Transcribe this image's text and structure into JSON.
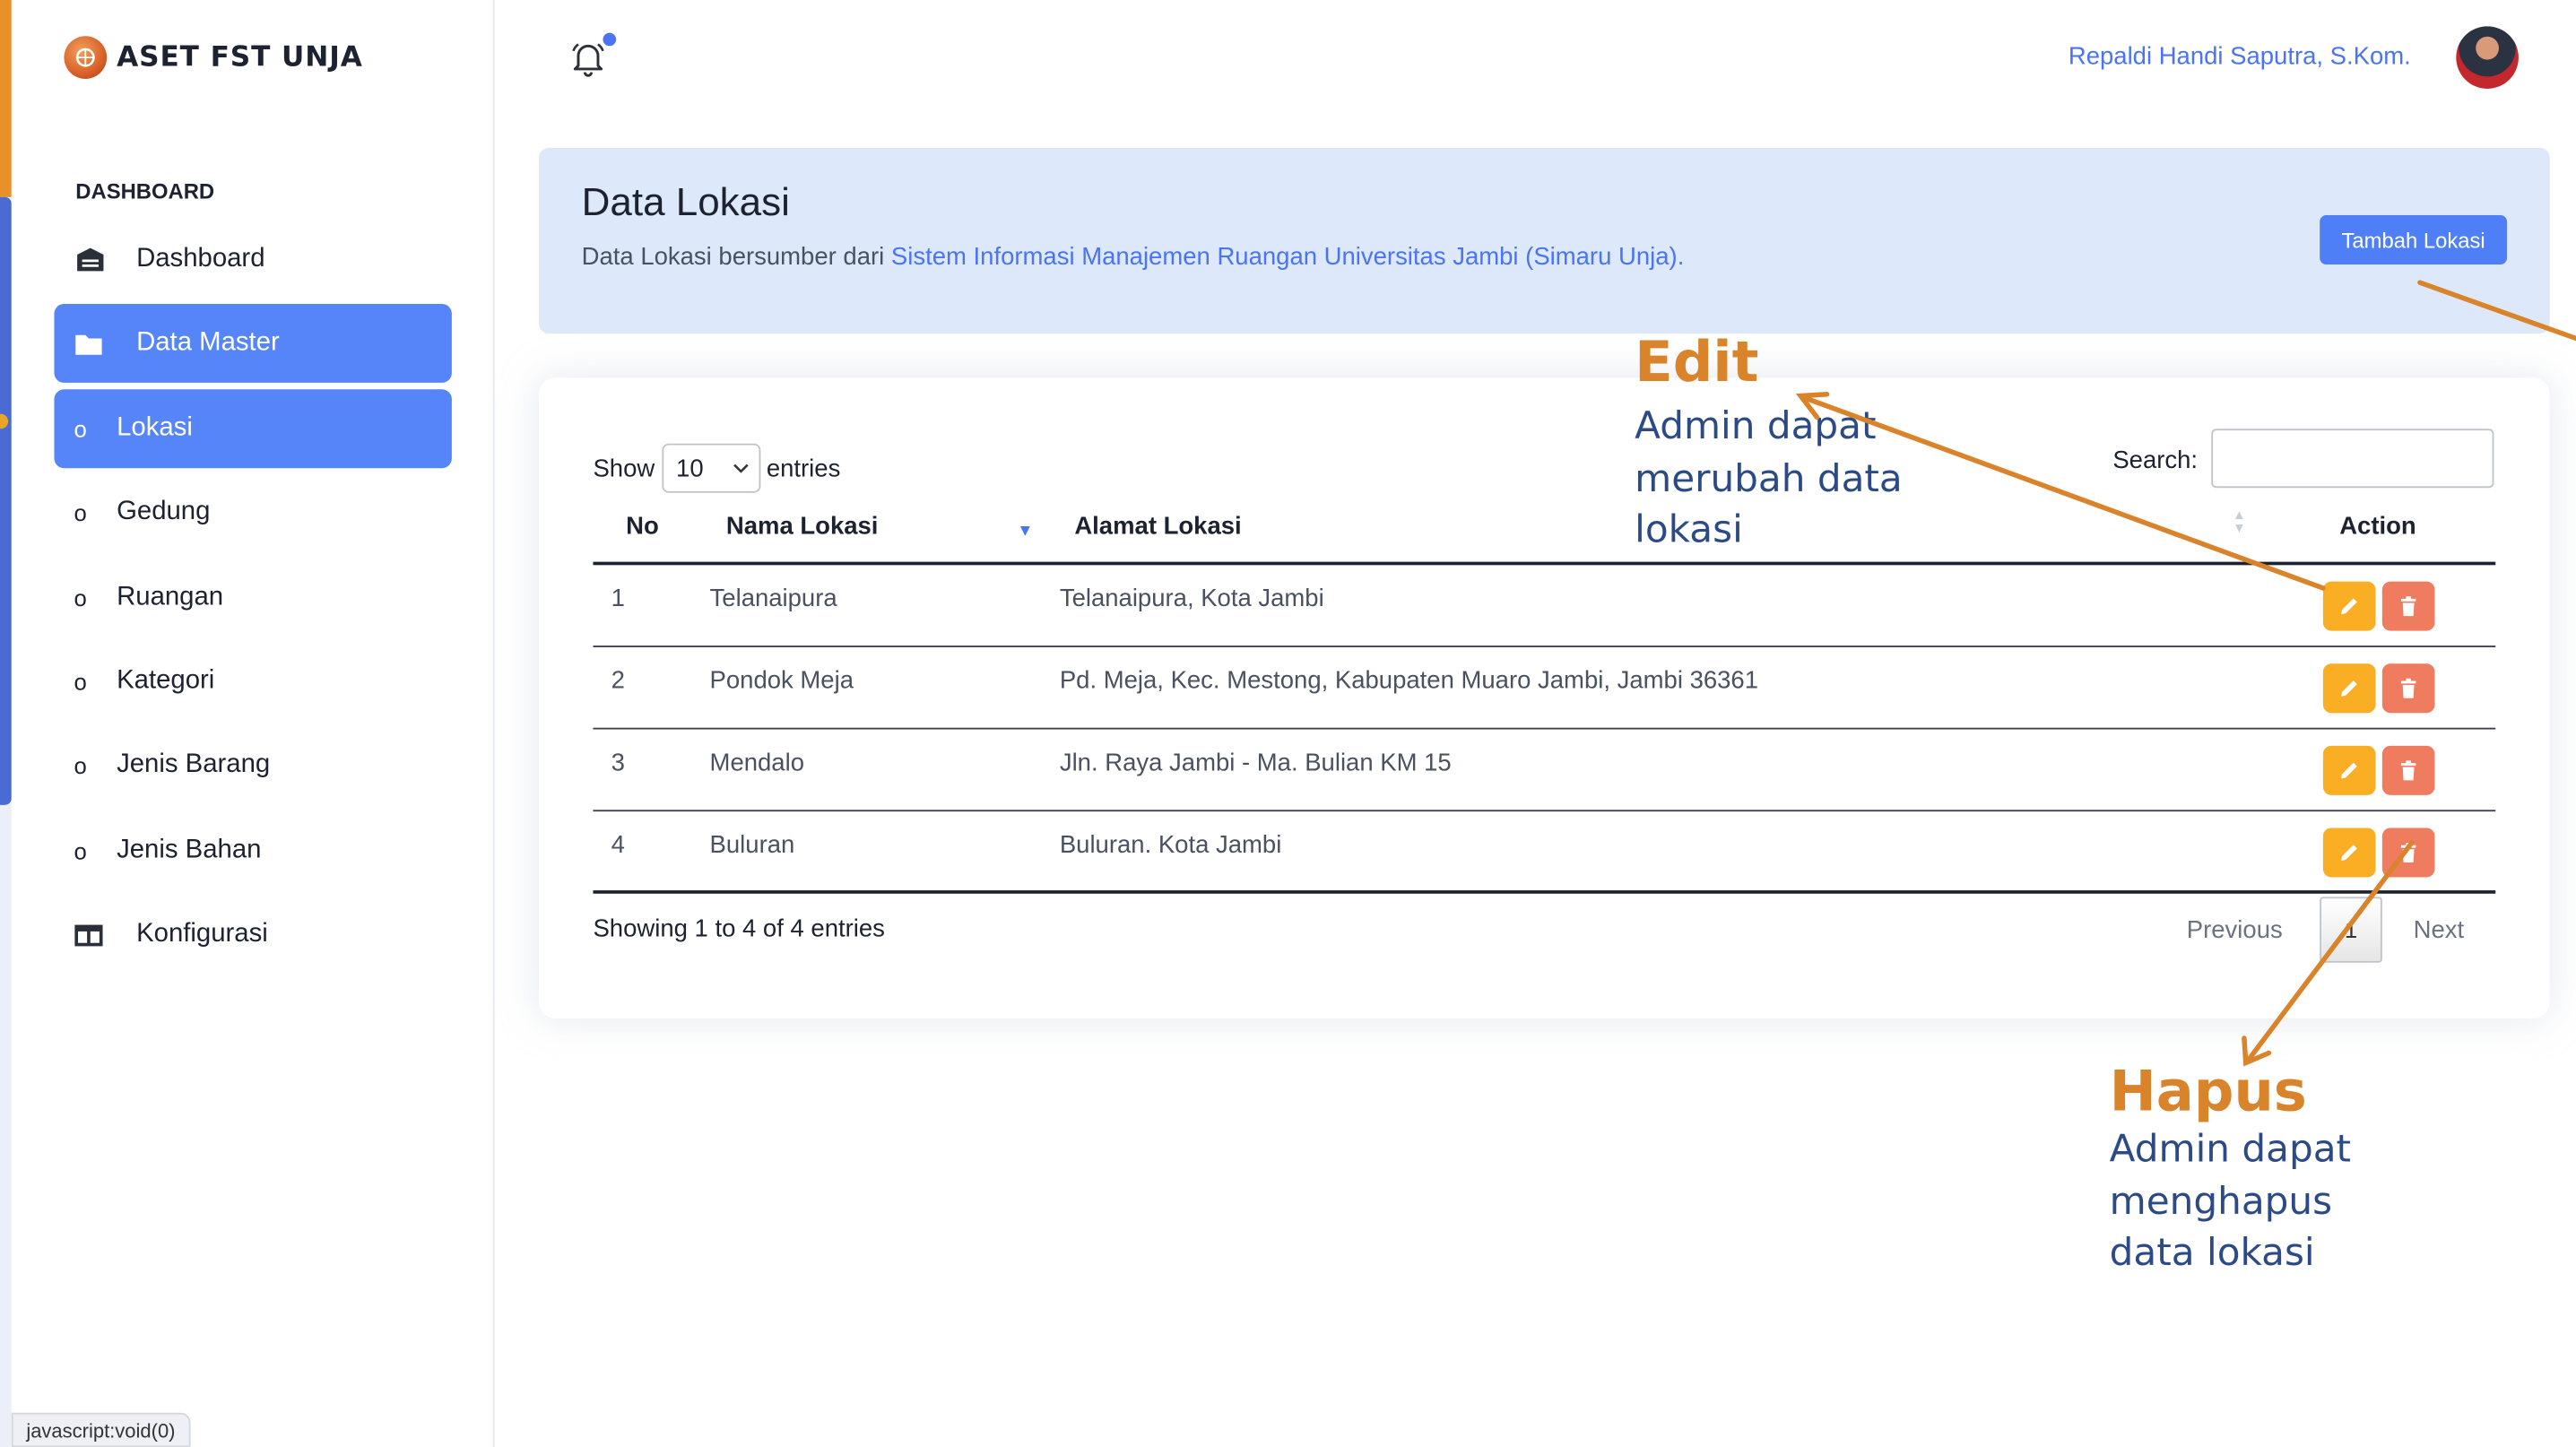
{
  "app": {
    "brand": "ASET FST UNJA",
    "status_bar": "javascript:void(0)"
  },
  "sidebar": {
    "section_title": "DASHBOARD",
    "items": [
      {
        "label": "Dashboard",
        "icon": "dashboard-icon",
        "active": false
      },
      {
        "label": "Data Master",
        "icon": "folder-icon",
        "active": true
      },
      {
        "label": "Lokasi",
        "icon": "bullet",
        "active": true
      },
      {
        "label": "Gedung",
        "icon": "bullet",
        "active": false
      },
      {
        "label": "Ruangan",
        "icon": "bullet",
        "active": false
      },
      {
        "label": "Kategori",
        "icon": "bullet",
        "active": false
      },
      {
        "label": "Jenis Barang",
        "icon": "bullet",
        "active": false
      },
      {
        "label": "Jenis Bahan",
        "icon": "bullet",
        "active": false
      },
      {
        "label": "Konfigurasi",
        "icon": "columns-icon",
        "active": false
      }
    ],
    "active_color": "#5585f8"
  },
  "topbar": {
    "user_name": "Repaldi Handi Saputra, S.Kom.",
    "bell_icon": "bell-icon",
    "accent": "#4a74f0"
  },
  "header": {
    "title": "Data Lokasi",
    "desc_prefix": "Data Lokasi bersumber dari ",
    "desc_link": "Sistem Informasi Manajemen Ruangan Universitas Jambi (Simaru Unja).",
    "add_button": "Tambah Lokasi"
  },
  "table": {
    "show_label": "Show",
    "entries_value": "10",
    "entries_label": "entries",
    "search_label": "Search:",
    "search_value": "",
    "columns": [
      "No",
      "Nama Lokasi",
      "Alamat Lokasi",
      "Action"
    ],
    "rows": [
      {
        "no": "1",
        "nama": "Telanaipura",
        "alamat": "Telanaipura, Kota Jambi"
      },
      {
        "no": "2",
        "nama": "Pondok Meja",
        "alamat": "Pd. Meja, Kec. Mestong, Kabupaten Muaro Jambi, Jambi 36361"
      },
      {
        "no": "3",
        "nama": "Mendalo",
        "alamat": "Jln. Raya Jambi - Ma. Bulian KM 15"
      },
      {
        "no": "4",
        "nama": "Buluran",
        "alamat": "Buluran. Kota Jambi"
      }
    ],
    "info": "Showing 1 to 4 of 4 entries",
    "pagination": {
      "previous": "Previous",
      "current": "1",
      "next": "Next"
    },
    "edit_color": "#f9ae24",
    "delete_color": "#f07c60"
  },
  "annotations": {
    "edit": {
      "title": "Edit",
      "lines": [
        "Admin dapat",
        "merubah data",
        "lokasi"
      ]
    },
    "hapus": {
      "title": "Hapus",
      "lines": [
        "Admin dapat",
        "menghapus",
        "data lokasi"
      ]
    },
    "color": "#d9832a"
  }
}
